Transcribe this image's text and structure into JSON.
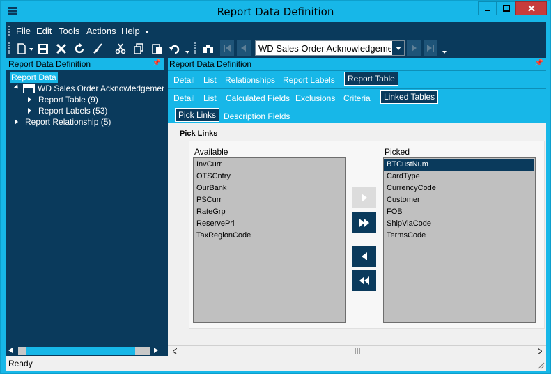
{
  "window": {
    "title": "Report Data Definition"
  },
  "menu": {
    "file": "File",
    "edit": "Edit",
    "tools": "Tools",
    "actions": "Actions",
    "help": "Help"
  },
  "toolbar": {
    "record_combo_value": "WD Sales Order Acknowledgement"
  },
  "left_pane": {
    "header": "Report Data Definition",
    "tree": {
      "root": "Report Data",
      "node": "WD Sales Order Acknowledgement",
      "report_table": "Report Table (9)",
      "report_labels": "Report Labels (53)",
      "report_relationship": "Report Relationship (5)"
    }
  },
  "right_pane": {
    "header": "Report Data Definition",
    "tabs_level1": [
      "Detail",
      "List",
      "Relationships",
      "Report Labels",
      "Report Table"
    ],
    "tabs_level2": [
      "Detail",
      "List",
      "Calculated Fields",
      "Exclusions",
      "Criteria",
      "Linked Tables"
    ],
    "tabs_level3": [
      "Pick Links",
      "Description Fields"
    ],
    "section_title": "Pick Links",
    "available_label": "Available",
    "picked_label": "Picked",
    "available": [
      "InvCurr",
      "OTSCntry",
      "OurBank",
      "PSCurr",
      "RateGrp",
      "ReservePri",
      "TaxRegionCode"
    ],
    "picked": [
      "BTCustNum",
      "CardType",
      "CurrencyCode",
      "Customer",
      "FOB",
      "ShipViaCode",
      "TermsCode"
    ]
  },
  "status": {
    "text": "Ready"
  },
  "colors": {
    "accent": "#17b7e8",
    "dark": "#0a3a5c"
  }
}
